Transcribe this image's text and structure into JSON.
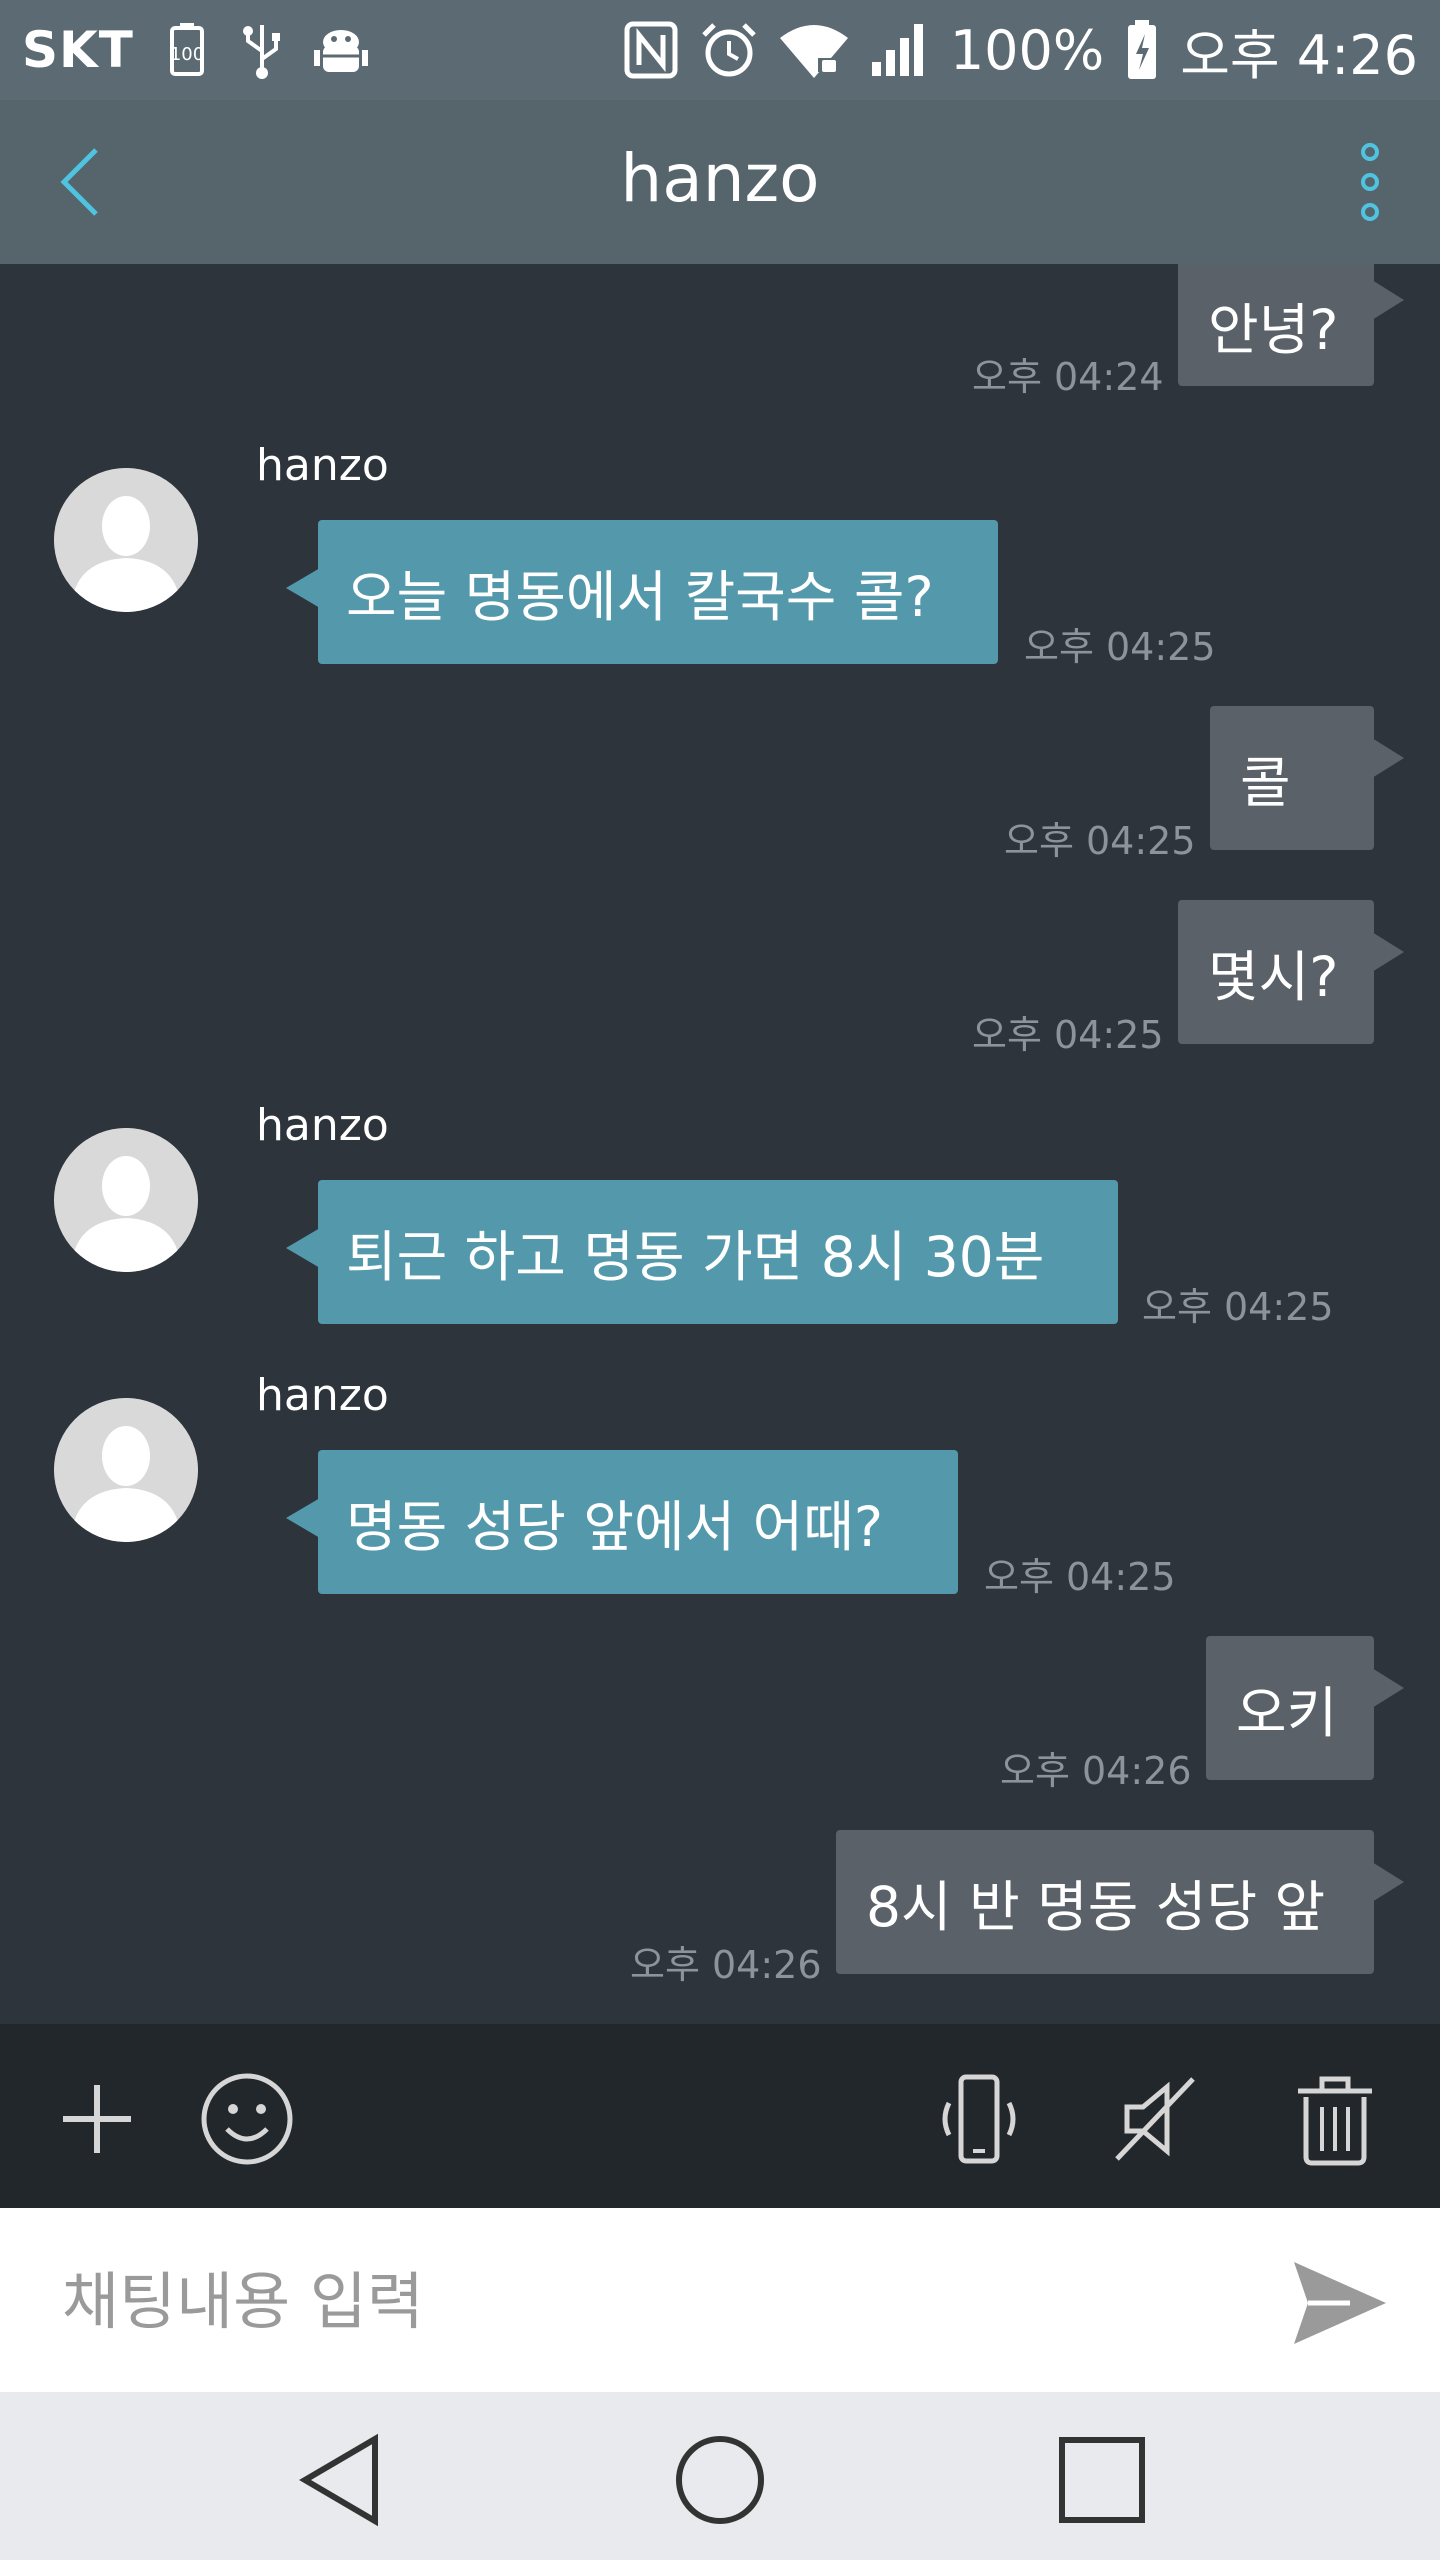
{
  "status_bar": {
    "carrier": "SKT",
    "battery_percent": "100%",
    "time": "오후 4:26",
    "icons": [
      "battery-saver-icon",
      "usb-icon",
      "android-debug-icon",
      "nfc-icon",
      "alarm-icon",
      "wifi-icon",
      "signal-icon",
      "battery-charging-icon"
    ]
  },
  "header": {
    "title": "hanzo",
    "back_icon": "chevron-left-icon",
    "menu_icon": "more-vertical-icon"
  },
  "messages": [
    {
      "direction": "out",
      "text": "안녕?",
      "time": "오후 04:24"
    },
    {
      "direction": "in",
      "sender": "hanzo",
      "text": "오늘 명동에서 칼국수 콜?",
      "time": "오후 04:25"
    },
    {
      "direction": "out",
      "text": "콜",
      "time": "오후 04:25"
    },
    {
      "direction": "out",
      "text": "몇시?",
      "time": "오후 04:25"
    },
    {
      "direction": "in",
      "sender": "hanzo",
      "text": "퇴근 하고 명동 가면 8시 30분",
      "time": "오후 04:25"
    },
    {
      "direction": "in",
      "sender": "hanzo",
      "text": "명동 성당 앞에서 어때?",
      "time": "오후 04:25"
    },
    {
      "direction": "out",
      "text": "오키",
      "time": "오후 04:26"
    },
    {
      "direction": "out",
      "text": "8시 반 명동 성당 앞",
      "time": "오후 04:26"
    }
  ],
  "toolbar": {
    "icons": [
      "plus-icon",
      "emoji-icon",
      "vibrate-icon",
      "mute-icon",
      "trash-icon"
    ]
  },
  "input": {
    "placeholder": "채팅내용 입력",
    "value": "",
    "send_icon": "send-icon"
  },
  "nav_bar": {
    "icons": [
      "nav-back-icon",
      "nav-home-icon",
      "nav-recents-icon"
    ]
  },
  "colors": {
    "status_bar_bg": "#5c6b73",
    "header_bg": "#56646b",
    "chat_bg": "#2e343c",
    "outgoing_bubble": "#5a6169",
    "incoming_bubble": "#5399ab",
    "accent": "#4fc3e0",
    "toolbar_bg": "#22272b"
  }
}
